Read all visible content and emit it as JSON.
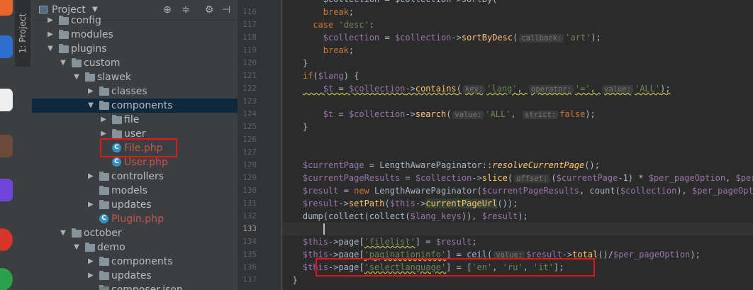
{
  "project_panel": {
    "title": "Project",
    "side_tab": "1: Project",
    "tree": [
      {
        "label": "config",
        "depth": 1,
        "type": "folder",
        "expanded": false
      },
      {
        "label": "modules",
        "depth": 1,
        "type": "folder",
        "expanded": false
      },
      {
        "label": "plugins",
        "depth": 1,
        "type": "folder",
        "expanded": true
      },
      {
        "label": "custom",
        "depth": 2,
        "type": "folder",
        "expanded": true
      },
      {
        "label": "slawek",
        "depth": 3,
        "type": "folder",
        "expanded": true
      },
      {
        "label": "classes",
        "depth": 4,
        "type": "folder",
        "expanded": false
      },
      {
        "label": "components",
        "depth": 4,
        "type": "folder",
        "expanded": true
      },
      {
        "label": "file",
        "depth": 5,
        "type": "folder",
        "expanded": false
      },
      {
        "label": "user",
        "depth": 5,
        "type": "folder",
        "expanded": false
      },
      {
        "label": "File.php",
        "depth": 5,
        "type": "php",
        "modified": true
      },
      {
        "label": "User.php",
        "depth": 5,
        "type": "php",
        "modified": true
      },
      {
        "label": "controllers",
        "depth": 4,
        "type": "folder",
        "expanded": false
      },
      {
        "label": "models",
        "depth": 4,
        "type": "folder",
        "leaf": true
      },
      {
        "label": "updates",
        "depth": 4,
        "type": "folder",
        "expanded": false
      },
      {
        "label": "Plugin.php",
        "depth": 4,
        "type": "php",
        "modified": true
      },
      {
        "label": "october",
        "depth": 2,
        "type": "folder",
        "expanded": true
      },
      {
        "label": "demo",
        "depth": 3,
        "type": "folder",
        "expanded": true
      },
      {
        "label": "components",
        "depth": 4,
        "type": "folder",
        "expanded": false
      },
      {
        "label": "updates",
        "depth": 4,
        "type": "folder",
        "expanded": false
      },
      {
        "label": "composer.json",
        "depth": 4,
        "type": "file"
      }
    ]
  },
  "editor": {
    "current_line": "133",
    "lines": [
      {
        "n": "116",
        "indent": 8,
        "tokens": [
          {
            "t": "$collection = $collection->sortBy(",
            "c": "plain"
          }
        ]
      },
      {
        "n": "117",
        "indent": 8,
        "tokens": [
          {
            "t": "break",
            "c": "kw"
          },
          {
            "t": ";",
            "c": "plain"
          }
        ]
      },
      {
        "n": "118",
        "indent": 6,
        "tokens": [
          {
            "t": "case ",
            "c": "kw"
          },
          {
            "t": "'desc'",
            "c": "str"
          },
          {
            "t": ":",
            "c": "plain"
          }
        ]
      },
      {
        "n": "119",
        "indent": 8,
        "tokens": [
          {
            "t": "$collection",
            "c": "var"
          },
          {
            "t": " = ",
            "c": "plain"
          },
          {
            "t": "$collection",
            "c": "var"
          },
          {
            "t": "->",
            "c": "plain"
          },
          {
            "t": "sortByDesc",
            "c": "fn"
          },
          {
            "t": "(",
            "c": "plain"
          },
          {
            "t": "callback:",
            "c": "hint"
          },
          {
            "t": "'art'",
            "c": "str"
          },
          {
            "t": ");",
            "c": "plain"
          }
        ]
      },
      {
        "n": "120",
        "indent": 8,
        "tokens": [
          {
            "t": "break",
            "c": "kw"
          },
          {
            "t": ";",
            "c": "plain"
          }
        ]
      },
      {
        "n": "121",
        "indent": 4,
        "tokens": [
          {
            "t": "}",
            "c": "plain"
          }
        ]
      },
      {
        "n": "122",
        "indent": 4,
        "tokens": [
          {
            "t": "if",
            "c": "kw"
          },
          {
            "t": "(",
            "c": "plain"
          },
          {
            "t": "$lang",
            "c": "var"
          },
          {
            "t": ") {",
            "c": "plain"
          }
        ]
      },
      {
        "n": "123",
        "indent": 4,
        "wavy": true,
        "tokens": [
          {
            "t": "    ",
            "c": "plain"
          },
          {
            "t": "$t",
            "c": "var"
          },
          {
            "t": " = ",
            "c": "plain"
          },
          {
            "t": "$collection",
            "c": "var"
          },
          {
            "t": "->",
            "c": "plain"
          },
          {
            "t": "contains",
            "c": "fn"
          },
          {
            "t": "(",
            "c": "plain"
          },
          {
            "t": "key:",
            "c": "hint"
          },
          {
            "t": "'lang'",
            "c": "str"
          },
          {
            "t": ", ",
            "c": "plain"
          },
          {
            "t": "operator:",
            "c": "hint"
          },
          {
            "t": "'='",
            "c": "str"
          },
          {
            "t": ", ",
            "c": "plain"
          },
          {
            "t": "value:",
            "c": "hint"
          },
          {
            "t": "'ALL'",
            "c": "str"
          },
          {
            "t": ");",
            "c": "plain"
          }
        ]
      },
      {
        "n": "124",
        "indent": 0,
        "tokens": []
      },
      {
        "n": "125",
        "indent": 8,
        "tokens": [
          {
            "t": "$t",
            "c": "var"
          },
          {
            "t": " = ",
            "c": "plain"
          },
          {
            "t": "$collection",
            "c": "var"
          },
          {
            "t": "->",
            "c": "plain"
          },
          {
            "t": "search",
            "c": "fn"
          },
          {
            "t": "(",
            "c": "plain"
          },
          {
            "t": "value:",
            "c": "hint"
          },
          {
            "t": "'ALL'",
            "c": "str"
          },
          {
            "t": ", ",
            "c": "plain"
          },
          {
            "t": "strict:",
            "c": "hint"
          },
          {
            "t": "false",
            "c": "kw"
          },
          {
            "t": ");",
            "c": "plain"
          }
        ]
      },
      {
        "n": "126",
        "indent": 4,
        "tokens": [
          {
            "t": "}",
            "c": "plain"
          }
        ]
      },
      {
        "n": "127",
        "indent": 0,
        "tokens": []
      },
      {
        "n": "128",
        "indent": 0,
        "tokens": []
      },
      {
        "n": "129",
        "indent": 4,
        "tokens": [
          {
            "t": "$currentPage",
            "c": "var"
          },
          {
            "t": " = LengthAwarePaginator::",
            "c": "plain"
          },
          {
            "t": "resolveCurrentPage",
            "c": "fnital"
          },
          {
            "t": "();",
            "c": "plain"
          }
        ]
      },
      {
        "n": "130",
        "indent": 4,
        "tokens": [
          {
            "t": "$currentPageResults",
            "c": "var"
          },
          {
            "t": " = ",
            "c": "plain"
          },
          {
            "t": "$collection",
            "c": "var"
          },
          {
            "t": "->",
            "c": "plain"
          },
          {
            "t": "slice",
            "c": "fn"
          },
          {
            "t": "(",
            "c": "plain"
          },
          {
            "t": "offset:",
            "c": "hint"
          },
          {
            "t": "(",
            "c": "plain"
          },
          {
            "t": "$currentPage",
            "c": "var"
          },
          {
            "t": "-1) * ",
            "c": "plain"
          },
          {
            "t": "$per_pageOption",
            "c": "var"
          },
          {
            "t": ", ",
            "c": "plain"
          },
          {
            "t": "$per_pageOption",
            "c": "var"
          },
          {
            "t": ");",
            "c": "plain"
          }
        ]
      },
      {
        "n": "131",
        "indent": 4,
        "tokens": [
          {
            "t": "$result",
            "c": "var"
          },
          {
            "t": " = ",
            "c": "plain"
          },
          {
            "t": "new ",
            "c": "kw"
          },
          {
            "t": "LengthAwarePaginator(",
            "c": "plain"
          },
          {
            "t": "$currentPageResults",
            "c": "var"
          },
          {
            "t": ", count(",
            "c": "plain"
          },
          {
            "t": "$collection",
            "c": "var"
          },
          {
            "t": "), ",
            "c": "plain"
          },
          {
            "t": "$per_pageOption",
            "c": "var"
          },
          {
            "t": ");",
            "c": "plain"
          }
        ]
      },
      {
        "n": "132",
        "indent": 4,
        "tokens": [
          {
            "t": "$result",
            "c": "var"
          },
          {
            "t": "->",
            "c": "plain"
          },
          {
            "t": "setPath",
            "c": "fn"
          },
          {
            "t": "(",
            "c": "plain"
          },
          {
            "t": "$this",
            "c": "var"
          },
          {
            "t": "->",
            "c": "plain"
          },
          {
            "t": "currentPageUrl",
            "c": "fnhl"
          },
          {
            "t": "());",
            "c": "plain"
          }
        ]
      },
      {
        "n": "133",
        "indent": 4,
        "tokens": [
          {
            "t": "dump(collect(collect(",
            "c": "plain"
          },
          {
            "t": "$lang_keys",
            "c": "var"
          },
          {
            "t": ")), ",
            "c": "plain"
          },
          {
            "t": "$result",
            "c": "var"
          },
          {
            "t": ");",
            "c": "plain"
          }
        ]
      },
      {
        "n": "134",
        "indent": 4,
        "tokens": []
      },
      {
        "n": "135",
        "indent": 4,
        "tokens": [
          {
            "t": "$this",
            "c": "var"
          },
          {
            "t": "->page[",
            "c": "plain"
          },
          {
            "t": "'filelist'",
            "c": "strwavy"
          },
          {
            "t": "] = ",
            "c": "plain"
          },
          {
            "t": "$result",
            "c": "var"
          },
          {
            "t": ";",
            "c": "plain"
          }
        ]
      },
      {
        "n": "136",
        "indent": 4,
        "tokens": [
          {
            "t": "$this",
            "c": "var"
          },
          {
            "t": "->page[",
            "c": "plain"
          },
          {
            "t": "'paginationinfo'",
            "c": "strwavy"
          },
          {
            "t": "] = ceil(",
            "c": "plain"
          },
          {
            "t": "value:",
            "c": "hint"
          },
          {
            "t": "$result",
            "c": "var"
          },
          {
            "t": "->",
            "c": "plain"
          },
          {
            "t": "total",
            "c": "fn"
          },
          {
            "t": "()/",
            "c": "plain"
          },
          {
            "t": "$per_pageOption",
            "c": "var"
          },
          {
            "t": ");",
            "c": "plain"
          }
        ]
      },
      {
        "n": "137",
        "indent": 4,
        "tokens": [
          {
            "t": "$this",
            "c": "var"
          },
          {
            "t": "->page[",
            "c": "plain"
          },
          {
            "t": "'selectlanguage'",
            "c": "strwavy"
          },
          {
            "t": "] = [",
            "c": "plain"
          },
          {
            "t": "'en'",
            "c": "str"
          },
          {
            "t": ", ",
            "c": "plain"
          },
          {
            "t": "'ru'",
            "c": "str"
          },
          {
            "t": ", ",
            "c": "plain"
          },
          {
            "t": "'it'",
            "c": "str"
          },
          {
            "t": "];",
            "c": "plain"
          }
        ]
      },
      {
        "n": "",
        "indent": 2,
        "tokens": [
          {
            "t": "}",
            "c": "plain"
          }
        ]
      }
    ],
    "gutter_numbers": [
      "116",
      "117",
      "118",
      "119",
      "120",
      "121",
      "122",
      "123",
      "124",
      "125",
      "126",
      "127",
      "128",
      "129",
      "130",
      "131",
      "132",
      "133",
      "134",
      "135",
      "136",
      "137"
    ]
  },
  "colors": {
    "highlight_box": "#e8141c",
    "background": "#2b2b2b",
    "panel": "#3c3f41"
  }
}
